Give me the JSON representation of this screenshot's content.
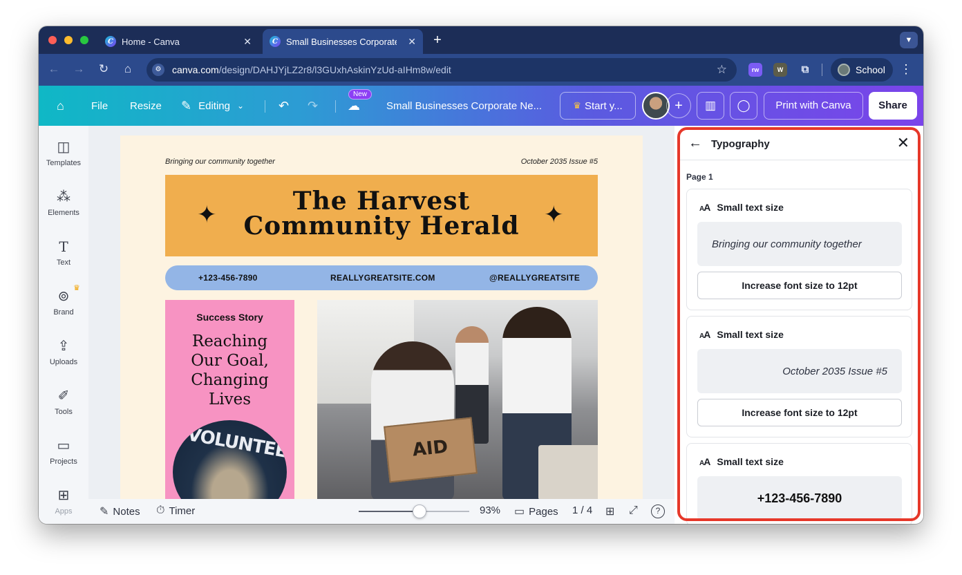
{
  "browser": {
    "tabs": [
      {
        "title": "Home - Canva",
        "close": "✕"
      },
      {
        "title": "Small Businesses Corporate N",
        "close": "✕"
      }
    ],
    "new_tab": "+",
    "url_host": "canva.com",
    "url_path": "/design/DAHJYjLZ2r8/l3GUxhAskinYzUd-aIHm8w/edit",
    "profile_label": "School"
  },
  "canva_header": {
    "file": "File",
    "resize": "Resize",
    "editing": "Editing",
    "new_badge": "New",
    "doc_title": "Small Businesses Corporate Ne...",
    "start": "Start y...",
    "print": "Print with Canva",
    "share": "Share"
  },
  "sidebar": {
    "items": [
      {
        "label": "Templates",
        "icon": "templates-icon"
      },
      {
        "label": "Elements",
        "icon": "elements-icon"
      },
      {
        "label": "Text",
        "icon": "text-icon"
      },
      {
        "label": "Brand",
        "icon": "brand-icon"
      },
      {
        "label": "Uploads",
        "icon": "uploads-icon"
      },
      {
        "label": "Tools",
        "icon": "tools-icon"
      },
      {
        "label": "Projects",
        "icon": "projects-icon"
      },
      {
        "label": "Apps",
        "icon": "apps-icon"
      }
    ]
  },
  "design": {
    "tagline": "Bringing our community together",
    "issue": "October 2035 Issue #5",
    "title_line1": "The Harvest",
    "title_line2": "Community Herald",
    "phone": "+123-456-7890",
    "site": "REALLYGREATSITE.COM",
    "handle": "@REALLYGREATSITE",
    "story_kicker": "Success Story",
    "story_headline": [
      "Reaching",
      "Our Goal,",
      "Changing",
      "Lives"
    ],
    "pink_photo_text": "VOLUNTEER",
    "box_label": "AID"
  },
  "bottom_bar": {
    "notes": "Notes",
    "timer": "Timer",
    "zoom_percent": 93,
    "zoom": "93%",
    "pages": "Pages",
    "page_count": "1 / 4"
  },
  "typography_panel": {
    "title": "Typography",
    "section": "Page 1",
    "issues": [
      {
        "heading": "Small text size",
        "preview": "Bringing our community together",
        "fix": "Increase font size to 12pt"
      },
      {
        "heading": "Small text size",
        "preview": "October 2035 Issue #5",
        "fix": "Increase font size to 12pt"
      },
      {
        "heading": "Small text size",
        "preview": "+123-456-7890"
      }
    ]
  },
  "colors": {
    "highlight_border": "#e6382a",
    "masthead": "#f0ae4e",
    "contact_bar": "#93b5e6",
    "story_box": "#f793c2",
    "page_bg": "#fdf3e1"
  }
}
